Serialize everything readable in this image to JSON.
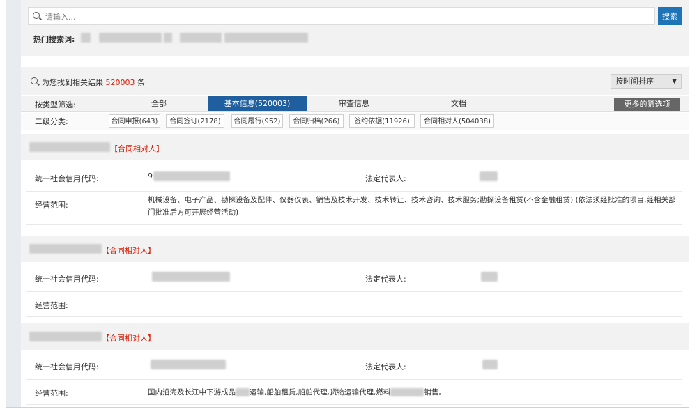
{
  "search": {
    "placeholder": "请输入...",
    "button_label": "搜索",
    "hot_label": "热门搜索词:"
  },
  "results": {
    "prefix": "为您找到相关结果",
    "count": "520003",
    "suffix": "条",
    "sort_label": "按时间排序"
  },
  "filter": {
    "label": "按类型筛选:",
    "tabs": [
      "全部",
      "基本信息(520003)",
      "审查信息",
      "文档"
    ],
    "active_index": 1,
    "more_label": "更多的筛选项"
  },
  "subfilter": {
    "label": "二级分类:",
    "tags": [
      "合同申报(643)",
      "合同签订(2178)",
      "合同履行(952)",
      "合同归档(266)",
      "签约依据(11926)",
      "合同相对人(504038)"
    ]
  },
  "records": [
    {
      "tag": "【合同相对人】",
      "code_label": "统一社会信用代码:",
      "rep_label": "法定代表人:",
      "scope_label": "经营范围:",
      "code_prefix": "9",
      "scope_text": "机械设备、电子产品、勘探设备及配件、仪器仪表、销售及技术开发、技术转让、技术咨询、技术服务;勘探设备租赁(不含金融租赁) (依法须经批准的项目,经相关部门批准后方可开展经营活动)"
    },
    {
      "tag": "【合同相对人】",
      "code_label": "统一社会信用代码:",
      "rep_label": "法定代表人:",
      "scope_label": "经营范围:",
      "code_prefix": "",
      "scope_text": ""
    },
    {
      "tag": "【合同相对人】",
      "code_label": "统一社会信用代码:",
      "rep_label": "法定代表人:",
      "scope_label": "经营范围:",
      "code_prefix": "",
      "scope_text": "国内沿海及长江中下游成品",
      "scope_text_mid": "运输,船舶租赁,船舶代理,货物运输代理,燃料",
      "scope_text_end": "销售。"
    }
  ],
  "colors": {
    "primary": "#1f73b7",
    "active_tab": "#1f5fa0",
    "accent_red": "#d81e06",
    "more_button": "#666666"
  }
}
